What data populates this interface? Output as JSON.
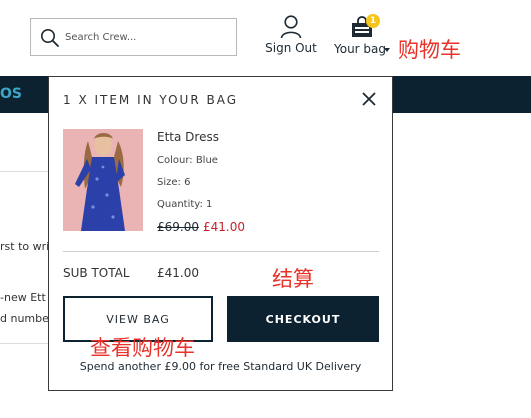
{
  "header": {
    "search_placeholder": "Search Crew...",
    "sign_out_label": "Sign Out",
    "bag_label": "Your bag",
    "bag_count": "1"
  },
  "navbar": {
    "fragment": "OS"
  },
  "background": {
    "line1": "rst to writ",
    "line2": "-new Ett",
    "line3": "d number"
  },
  "bag_dropdown": {
    "title": "1 X ITEM IN YOUR BAG",
    "item": {
      "name": "Etta Dress",
      "colour": "Colour: Blue",
      "size": "Size: 6",
      "quantity": "Quantity: 1",
      "price_old": "£69.00",
      "price_new": "£41.00"
    },
    "subtotal_label": "SUB TOTAL",
    "subtotal_value": "£41.00",
    "view_bag_label": "VIEW BAG",
    "checkout_label": "CHECKOUT",
    "delivery_message": "Spend another £9.00 for free Standard UK Delivery"
  },
  "annotations": {
    "cart": "购物车",
    "checkout": "结算",
    "view_cart": "查看购物车"
  },
  "colors": {
    "navy": "#0d2230",
    "sale_red": "#c8212b",
    "badge_yellow": "#f6c51a",
    "annotation_red": "#e8322a"
  }
}
